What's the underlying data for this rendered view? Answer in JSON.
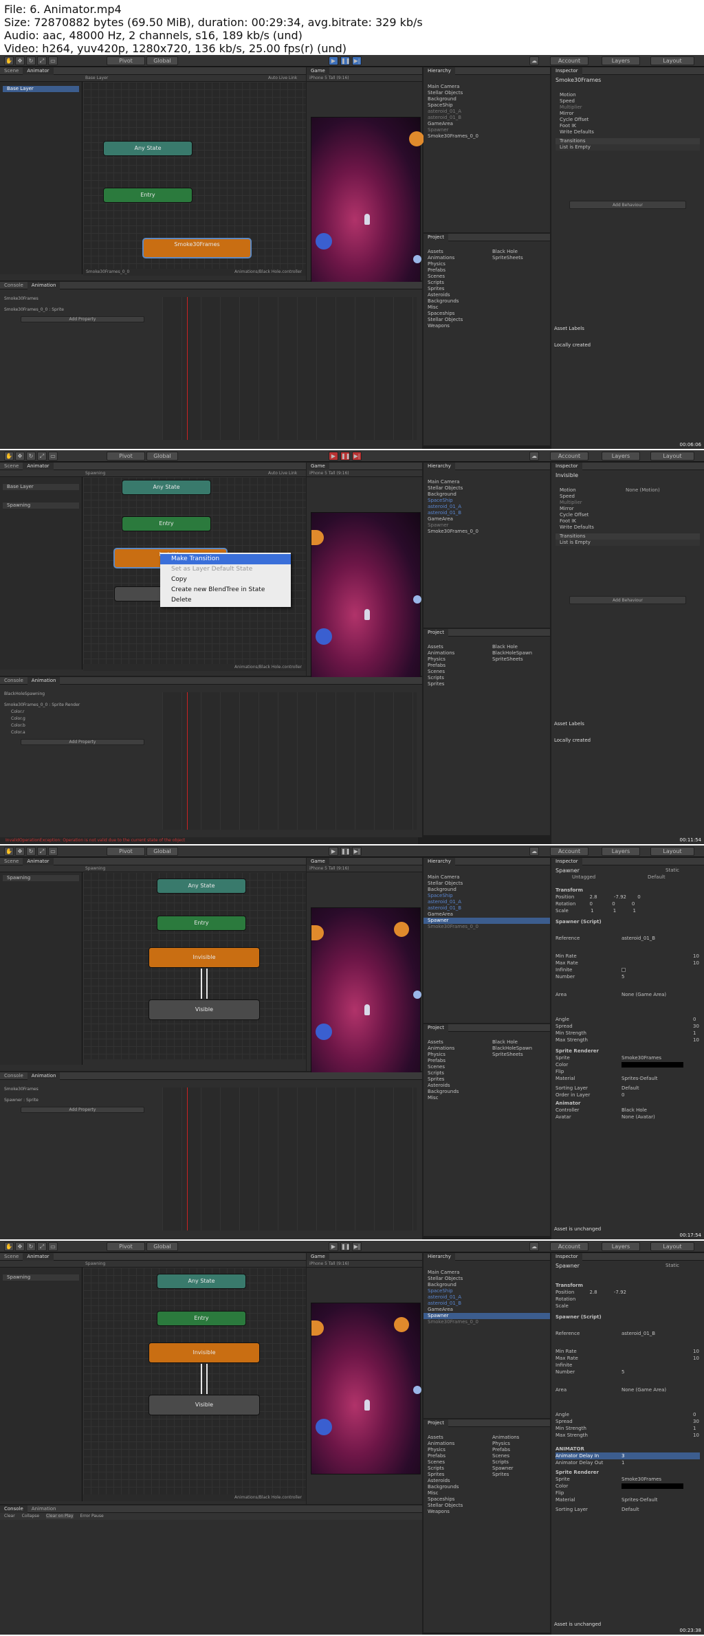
{
  "file_info": {
    "line1": "File: 6. Animator.mp4",
    "line2": "Size: 72870882 bytes (69.50 MiB), duration: 00:29:34, avg.bitrate: 329 kb/s",
    "line3": "Audio: aac, 48000 Hz, 2 channels, s16, 189 kb/s (und)",
    "line4": "Video: h264, yuv420p, 1280x720, 136 kb/s, 25.00 fps(r) (und)"
  },
  "toolbar": {
    "pivot": "Pivot",
    "global": "Global",
    "account": "Account",
    "layers": "Layers",
    "layout": "Layout"
  },
  "tabs": {
    "scene": "Scene",
    "animator": "Animator",
    "game": "Game",
    "hierarchy": "Hierarchy",
    "project": "Project",
    "inspector": "Inspector",
    "console": "Console",
    "animation": "Animation"
  },
  "colors": {
    "state_any": "#397a6c",
    "state_entry": "#2b7a3d",
    "state_orange": "#c96e12",
    "state_gray": "#4a4a4a",
    "selection": "#3c5d8e"
  },
  "frames": [
    {
      "timestamp": "00:06:06",
      "animator_breadcrumb": "Base Layer",
      "auto_live_link": "Auto Live Link",
      "layer_items": [
        "Base Layer"
      ],
      "game_resolution": "iPhone 5 Tall (9:16)",
      "states": {
        "any": "Any State",
        "entry": "Entry",
        "orange": "Smoke30Frames",
        "gray": ""
      },
      "hierarchy": [
        "Main Camera",
        "Stellar Objects",
        "Background",
        "SpaceShip",
        "asteroid_01_A",
        "asteroid_01_B",
        "GameArea",
        "Spawner",
        "Smoke30Frames_0_0"
      ],
      "project_assets": [
        "Assets",
        "Animations",
        "Physics",
        "Prefabs",
        "Scenes",
        "Scripts",
        "Sprites",
        "Asteroids",
        "Backgrounds",
        "Misc",
        "Spaceships",
        "Stellar Objects",
        "Weapons"
      ],
      "project_files": [
        "Black Hole",
        "SpriteSheets"
      ],
      "anim_clip": "Smoke30Frames",
      "anim_track": "Smoke30Frames_0_0 : Sprite",
      "add_property": "Add Property",
      "footer_path": "Animations/Black Hole.controller",
      "bottom_left": "Smoke30Frames_0_0",
      "inspector_title": "Smoke30Frames",
      "inspector_rows": [
        "Motion",
        "Speed",
        "Multiplier",
        "Mirror",
        "Cycle Offset",
        "Foot IK",
        "Write Defaults",
        "Transitions",
        "List is Empty"
      ],
      "add_behaviour": "Add Behaviour",
      "asset_labels": "Asset Labels",
      "locally_created": "Locally created"
    },
    {
      "timestamp": "00:11:54",
      "animator_breadcrumb": "Spawning",
      "layer_items": [
        "Base Layer",
        "Spawning"
      ],
      "states": {
        "any": "Any State",
        "entry": "Entry",
        "orange": "Invisible",
        "gray": ""
      },
      "context_menu": [
        "Make Transition",
        "Set as Layer Default State",
        "Copy",
        "Create new BlendTree in State",
        "Delete"
      ],
      "anim_clip": "BlackHoleSpawning",
      "anim_track": "Smoke30Frames_0_0 : Sprite Render",
      "anim_subtracks": [
        "Color.r",
        "Color.g",
        "Color.b",
        "Color.a"
      ],
      "project_files": [
        "Black Hole",
        "BlackHoleSpawn",
        "SpriteSheets"
      ],
      "inspector_title": "Invisible",
      "motion_value": "None (Motion)",
      "error_text": "InvalidOperationException: Operation is not valid due to the current state of the object"
    },
    {
      "timestamp": "00:17:54",
      "animator_breadcrumb": "Spawning",
      "layer_items": [
        "Spawning"
      ],
      "states": {
        "any": "Any State",
        "entry": "Entry",
        "orange": "Invisible",
        "gray": "Visible"
      },
      "anim_track": "Spawner : Sprite",
      "inspector_title": "Spawner",
      "inspector_tag": "Untagged",
      "inspector_layer": "Default",
      "inspector_static": "Static",
      "transform": {
        "position": [
          "2.8",
          "-7.92",
          "0"
        ],
        "rotation": [
          "0",
          "0",
          "0"
        ],
        "scale": [
          "1",
          "1",
          "1"
        ]
      },
      "spawner_script": "Spawner (Script)",
      "reference": "asteroid_01_B",
      "spawning": {
        "min_rate": "10",
        "max_rate": "10",
        "number": "5"
      },
      "area": "None (Game Area)",
      "velocity": {
        "angle": "0",
        "spread": "30",
        "min_strength": "1",
        "max_strength": "10"
      },
      "sprite_renderer": {
        "sprite": "Smoke30Frames",
        "material": "Sprites-Default",
        "sorting_layer": "Default",
        "order_in_layer": "0"
      },
      "animator_controller": "Black Hole",
      "avatar": "None (Avatar)",
      "asset_unchanged": "Asset is unchanged"
    },
    {
      "timestamp": "00:23:38",
      "animator_breadcrumb": "Spawning",
      "states": {
        "any": "Any State",
        "entry": "Entry",
        "orange": "Invisible",
        "gray": "Visible"
      },
      "console_buttons": [
        "Clear",
        "Collapse",
        "Clear on Play",
        "Error Pause"
      ],
      "project_assets_list": [
        "Animations",
        "Physics",
        "Prefabs",
        "Scenes",
        "Scripts",
        "Spawner",
        "Sprites"
      ],
      "animator_section": "ANIMATOR",
      "animator_delay_in": "Animator Delay In",
      "animator_delay_out": "Animator Delay Out",
      "delay_in_value": "3",
      "delay_out_value": "1"
    }
  ]
}
